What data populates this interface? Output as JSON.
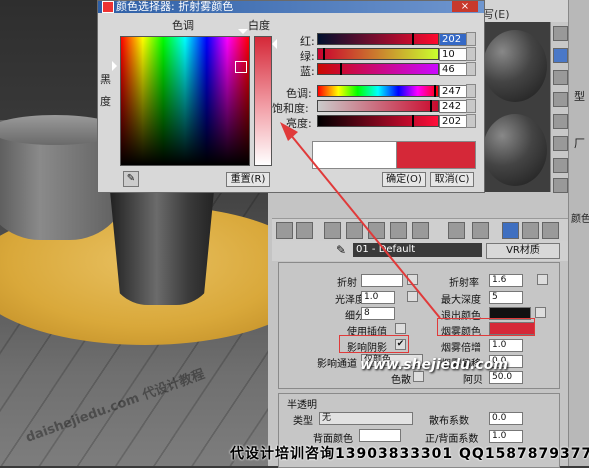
{
  "dialog": {
    "title": "颜色选择器: 折射雾颜色",
    "close": "×",
    "hue_label": "色调",
    "whiteness_label": "白度",
    "blackness_label": "黑",
    "degree_label": "度",
    "rgb": [
      {
        "label": "红:",
        "value": "202",
        "selected": true,
        "color": "#d52838"
      },
      {
        "label": "绿:",
        "value": "10"
      },
      {
        "label": "蓝:",
        "value": "46"
      }
    ],
    "hsv": [
      {
        "label": "色调:",
        "value": "247"
      },
      {
        "label": "饱和度:",
        "value": "242"
      },
      {
        "label": "亮度:",
        "value": "202"
      }
    ],
    "buttons": {
      "reset": "重置(R)",
      "ok": "确定(O)",
      "cancel": "取消(C)"
    },
    "old_color": "#ffffff",
    "new_color": "#d52838"
  },
  "top_tab": "写(E)",
  "material": {
    "name": "01 - Default",
    "type": "VR材质",
    "fields": {
      "refract_label": "折射",
      "ior_label": "折射率",
      "ior_value": "1.6",
      "gloss_label": "光泽度",
      "gloss_value": "1.0",
      "max_depth_label": "最大深度",
      "max_depth_value": "5",
      "subdiv_label": "细分",
      "subdiv_value": "8",
      "exit_color_label": "退出颜色",
      "use_interp_label": "使用插值",
      "fog_color_label": "烟雾颜色",
      "affect_shadow_label": "影响阴影",
      "affect_shadow_check": "✔",
      "fog_multiplier_label": "烟雾倍增",
      "fog_multiplier_value": "1.0",
      "affect_channel_label": "影响通道",
      "affect_channel_value": "仅颜色",
      "fog_bias_label": "烟雾偏移",
      "fog_bias_value": "0.0",
      "dispersion_label": "色散",
      "abbe_label": "阿贝",
      "abbe_value": "50.0"
    },
    "translucent": {
      "title": "半透明",
      "type_label": "类型",
      "type_value": "无",
      "back_color_label": "背面颜色",
      "scatter_label": "散布系数",
      "scatter_value": "0.0",
      "front_back_label": "正/背面系数",
      "front_back_value": "1.0"
    }
  },
  "side_labels": {
    "model": "型",
    "rr": "厂",
    "col": "颜色"
  },
  "watermark": "www.shejiedu.com",
  "viewport_watermark": "daishejiedu.com 代设计教程",
  "footer_text": "代设计培训咨询13903833301 QQ1587879377",
  "colors": {
    "accent_red": "#d52838",
    "title_blue": "#2e5fa6",
    "highlight": "#e03a3a"
  }
}
